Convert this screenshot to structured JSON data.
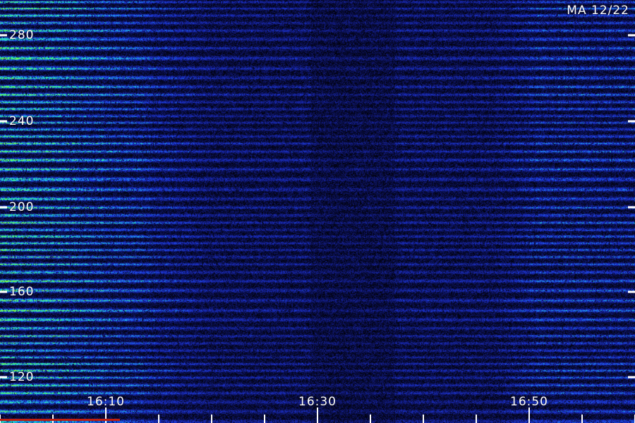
{
  "stamp": "MA 12/22",
  "y_axis": {
    "ticks": [
      "280",
      "240",
      "200",
      "160",
      "120"
    ],
    "range": [
      110,
      290
    ]
  },
  "x_axis": {
    "ticks": [
      "16:10",
      "16:30",
      "16:50"
    ],
    "range": [
      "16:02",
      "17:01"
    ]
  },
  "colors": {
    "low": "#000010",
    "mid": "#1a2ad8",
    "high": "#28e8e0",
    "peak": "#40ff50",
    "marker": "#c02010"
  }
}
